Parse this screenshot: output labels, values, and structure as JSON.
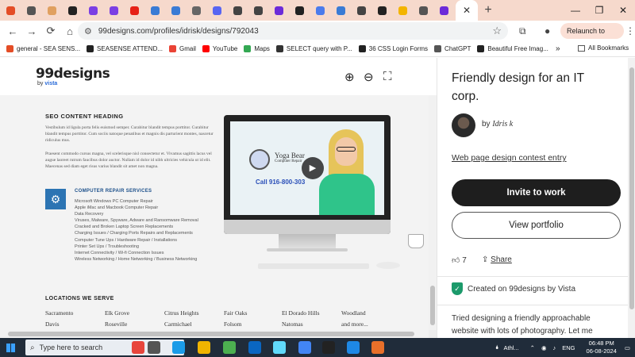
{
  "browser": {
    "tab_favicon_colors": [
      "#e44d26",
      "#555555",
      "#e0a060",
      "#222222",
      "#7b3fe4",
      "#7b3fe4",
      "#e62117",
      "#3a7bd5",
      "#3a7bd5",
      "#666666",
      "#5865f2",
      "#444444",
      "#444444",
      "#6c2bd9",
      "#222222",
      "#4b7bec",
      "#3a7bd5",
      "#444444",
      "#222222",
      "#f3b400",
      "#555555",
      "#6c2bd9"
    ],
    "active_tab_close": "✕",
    "new_tab_label": "+",
    "window_controls": {
      "minimize": "—",
      "restore": "❐",
      "close": "✕"
    },
    "url": "99designs.com/profiles/idrisk/designs/792043",
    "relaunch_label": "Relaunch to update",
    "bookmarks": [
      {
        "label": "general - SEA SENS...",
        "color": "#e44d26"
      },
      {
        "label": "SEASENSE ATTEND...",
        "color": "#222222"
      },
      {
        "label": "Gmail",
        "color": "#ea4335"
      },
      {
        "label": "YouTube",
        "color": "#ff0000"
      },
      {
        "label": "Maps",
        "color": "#34a853"
      },
      {
        "label": "SELECT query with P...",
        "color": "#333333"
      },
      {
        "label": "36 CSS Login Forms",
        "color": "#222222"
      },
      {
        "label": "ChatGPT",
        "color": "#555555"
      },
      {
        "label": "Beautiful Free Imag...",
        "color": "#222222"
      }
    ],
    "bookmarks_more": "»",
    "all_bookmarks_label": "All Bookmarks"
  },
  "design": {
    "logo_text": "99designs",
    "logo_by": "by",
    "logo_brand": "vista",
    "seo_heading": "SEO CONTENT HEADING",
    "seo_paragraph_1": "Vestibulum id ligula porta felis euismod semper. Curabitur blandit tempus porttitor. Curabitur blandit tempus porttitor. Cum sociis natoque penatibus et magnis dis parturient montes, nascetur ridiculus mus.",
    "seo_paragraph_2": "Praesent commodo cursus magna, vel scelerisque nisl consectetur et. Vivamus sagittis lacus vel augue laoreet rutrum faucibus dolor auctor. Nullam id dolor id nibh ultricies vehicula ut id elit. Maecenas sed diam eget risus varius blandit sit amet non magna.",
    "repair_title": "COMPUTER REPAIR SERVICES",
    "repair_items": [
      "Microsoft Windows PC Computer Repair",
      "Apple iMac and Macbook Computer Repair",
      "Data Recovery",
      "Viruses, Malware, Spyware, Adware and Ransomware Removal",
      "Cracked and Broken Laptop Screen Replacements",
      "Charging Issues / Charging Ports Repairs and Replacements",
      "Computer Tune Ups / Hardware Repair / Installations",
      "Printer Set Ups / Troubleshooting",
      "Internet Connectivity / Wi-fi Connection Issues",
      "Wireless Networking / Home Networking / Business Networking"
    ],
    "video_brand_line1": "Yoga Bear",
    "video_brand_line2": "Computer Repair",
    "video_phone": "Call 916-800-303",
    "locations_title": "LOCATIONS WE SERVE",
    "locations": [
      "Sacramento",
      "Elk Grove",
      "Citrus Heights",
      "Fair Oaks",
      "El Dorado Hills",
      "Woodland",
      "Davis",
      "Roseville",
      "Carmichael",
      "Folsom",
      "Natomas",
      "and more..."
    ]
  },
  "detail": {
    "title": "Friendly design for an IT corp.",
    "by_prefix": "by",
    "designer": "Idris k",
    "contest_link": "Web page design contest entry",
    "invite_label": "Invite to work",
    "portfolio_label": "View portfolio",
    "likes": "7",
    "share_label": "Share",
    "created_label": "Created on 99designs by Vista",
    "description": "Tried designing a friendly approachable website with lots of photography. Let me"
  },
  "taskbar": {
    "search_placeholder": "Type here to search",
    "app_colors": [
      "#e8453c",
      "#555555",
      "#1a9be8",
      "#f0b400",
      "#4caf50",
      "#0a66c2",
      "#61dafb",
      "#4285f4",
      "#222222",
      "#1e88e5",
      "#e8702a"
    ],
    "tray_app_label": "Athl...",
    "language": "ENG",
    "time": "06:48 PM",
    "date": "06-08-2024"
  }
}
